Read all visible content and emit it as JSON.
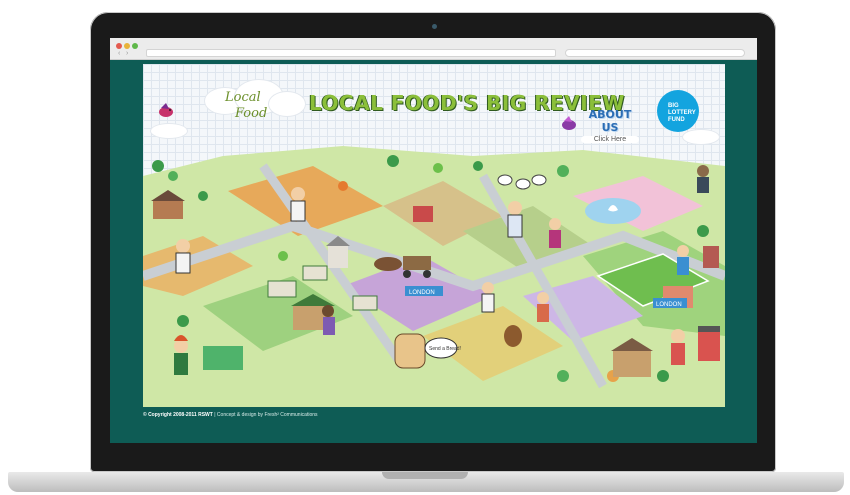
{
  "page": {
    "headline": "LOCAL FOOD'S BIG REVIEW",
    "logo": {
      "line1": "Local",
      "line2": "Food"
    },
    "about": {
      "title": "ABOUT US",
      "cta": "Click Here"
    },
    "lottery": {
      "line1": "BIG",
      "line2": "LOTTERY",
      "line3": "FUND"
    },
    "signs": {
      "london_1": "LONDON",
      "london_2": "LONDON"
    },
    "bubble": "Send a Bread!"
  },
  "footer": {
    "copyright": "© Copyright 2008-2011 RSWT",
    "separator": "|",
    "credit": "Concept & design by Fresh² Communications"
  },
  "colors": {
    "screen_bg": "#0e5c55",
    "headline": "#8bbf3a",
    "lottery": "#13a4df"
  }
}
